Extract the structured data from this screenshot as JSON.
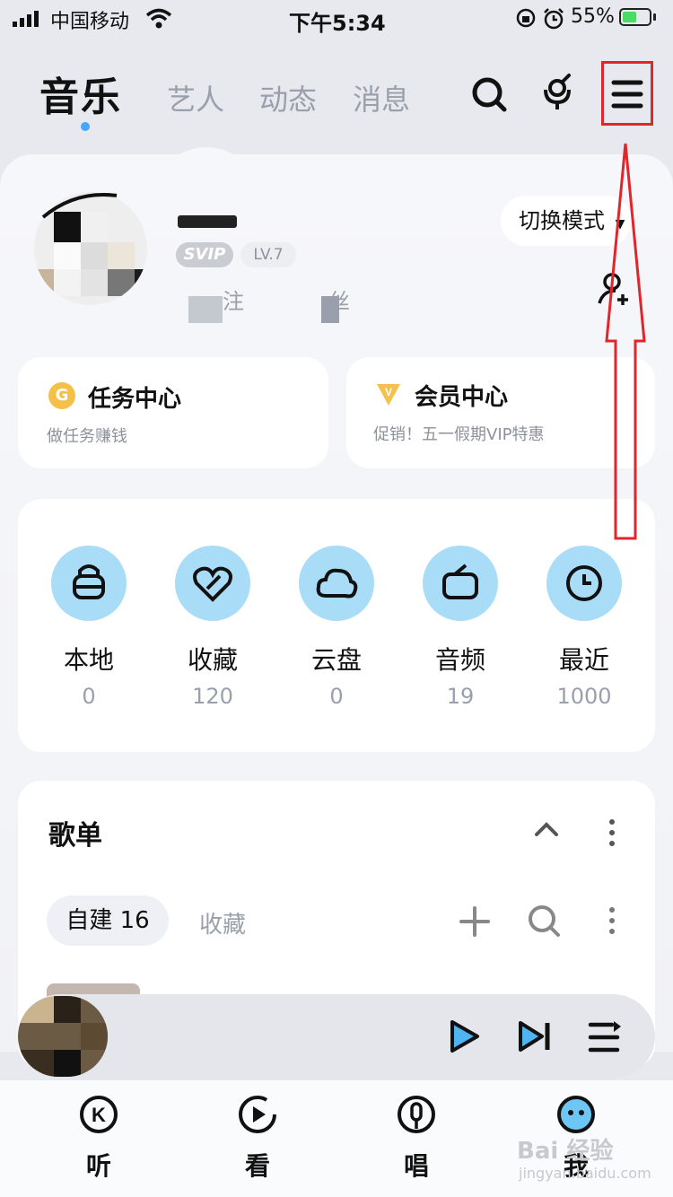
{
  "status_bar": {
    "carrier": "中国移动",
    "time": "下午5:34",
    "battery_percent": "55%",
    "battery_level": 0.55
  },
  "header": {
    "tabs": [
      {
        "label": "音乐",
        "active": true
      },
      {
        "label": "艺人",
        "active": false
      },
      {
        "label": "动态",
        "active": false
      },
      {
        "label": "消息",
        "active": false
      }
    ],
    "icons": [
      "search-icon",
      "microphone-icon",
      "menu-icon"
    ]
  },
  "profile": {
    "badges": {
      "svip": "SVIP",
      "level": "LV.7"
    },
    "mode_button": "切换模式",
    "follow_label": "注",
    "fans_label": "丝"
  },
  "features": [
    {
      "icon": "coin-icon",
      "icon_text": "G",
      "title": "任务中心",
      "subtitle": "做任务赚钱"
    },
    {
      "icon": "diamond-icon",
      "icon_text": "V",
      "title": "会员中心",
      "subtitle": "促销！五一假期VIP特惠"
    }
  ],
  "quick_access": [
    {
      "label": "本地",
      "count": "0",
      "icon": "bag-icon"
    },
    {
      "label": "收藏",
      "count": "120",
      "icon": "heart-icon"
    },
    {
      "label": "云盘",
      "count": "0",
      "icon": "cloud-icon"
    },
    {
      "label": "音频",
      "count": "19",
      "icon": "radio-icon"
    },
    {
      "label": "最近",
      "count": "1000",
      "icon": "clock-icon"
    }
  ],
  "playlist": {
    "title": "歌单",
    "tabs": [
      {
        "label": "自建 16",
        "active": true
      },
      {
        "label": "收藏",
        "active": false
      }
    ]
  },
  "bottom_nav": [
    {
      "label": "听",
      "icon": "listen-icon"
    },
    {
      "label": "看",
      "icon": "watch-icon"
    },
    {
      "label": "唱",
      "icon": "sing-icon"
    },
    {
      "label": "我",
      "icon": "me-icon",
      "active": true
    }
  ],
  "watermark": {
    "text": "Bai 经验",
    "sub": "jingyan.baidu.com"
  },
  "colors": {
    "accent": "#45a6ff",
    "highlight_red": "#e0252b",
    "circle_blue": "#a9dcf7"
  }
}
